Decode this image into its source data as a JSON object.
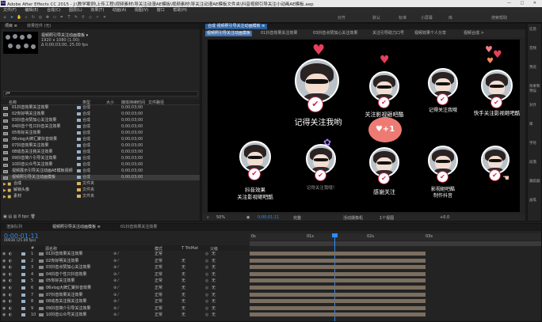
{
  "window": {
    "title": "Adobe After Effects CC 2015 - J:\\教学案例\\上传工程\\视频素材\\导关注动漫AE模板\\视频素材\\导关注动漫AE模板文件夹\\抖音视频引导关注小动画AE模板.aep",
    "app_icon": "Ae",
    "controls": [
      "—",
      "□",
      "✕"
    ]
  },
  "menu": [
    "文件(F)",
    "编辑(E)",
    "合成(C)",
    "图层(L)",
    "效果(T)",
    "动画(A)",
    "视图(V)",
    "窗口",
    "帮助(H)"
  ],
  "toolbar": {
    "right_items": [
      "对齐",
      "默认",
      "标准",
      "小屏幕",
      "库",
      "搜索帮助"
    ]
  },
  "project": {
    "tabs": [
      "项目 ≡",
      "效果控件 (无)"
    ],
    "selected_name": "视频照引导关注动画模板 ▾",
    "selected_info": [
      "1920 x 1080 (1.00)",
      "Δ 0;00;03;00, 25.00 fps"
    ],
    "search_placeholder": "ρ▾",
    "columns": [
      "名称",
      "类型",
      "大小",
      "媒体持续时间",
      "文件路径"
    ],
    "items": [
      {
        "name": "01抖音效果关注效果",
        "type": "合成",
        "dur": "0;00;03;00",
        "color": "#9ab0c8"
      },
      {
        "name": "02你好明关注效果",
        "type": "合成",
        "dur": "0;00;03;00",
        "color": "#9ab0c8"
      },
      {
        "name": "03抖音点赞加心关注效果",
        "type": "合成",
        "dur": "0;00;03;00",
        "color": "#9ab0c8"
      },
      {
        "name": "04抖音个性只抖音关注效果",
        "type": "合成",
        "dur": "0;00;03;00",
        "color": "#9ab0c8"
      },
      {
        "name": "05你好关注效果",
        "type": "合成",
        "dur": "0;00;03;00",
        "color": "#9ab0c8"
      },
      {
        "name": "06vlog大牌汇聚抖音效果",
        "type": "合成",
        "dur": "0;00;03;00",
        "color": "#9ab0c8"
      },
      {
        "name": "07抖音效果关注效果",
        "type": "合成",
        "dur": "0;00;03;00",
        "color": "#9ab0c8"
      },
      {
        "name": "08动态关注我关注效果",
        "type": "合成",
        "dur": "0;00;03;00",
        "color": "#9ab0c8"
      },
      {
        "name": "09抖音简介引导关注效果",
        "type": "合成",
        "dur": "0;00;03;00",
        "color": "#9ab0c8"
      },
      {
        "name": "10抖音公众号关注效果",
        "type": "合成",
        "dur": "0;00;03;00",
        "color": "#9ab0c8"
      },
      {
        "name": "视频展示引导关注动画AE模板视频",
        "type": "合成",
        "dur": "0;00;03;00",
        "color": "#9ab0c8"
      },
      {
        "name": "视频照引导关注动画模板",
        "type": "合成",
        "dur": "0;00;03;00",
        "color": "#9ab0c8",
        "selected": true
      },
      {
        "name": "合成",
        "type": "文件夹",
        "dur": "",
        "color": "#d9b45a",
        "folder": true
      },
      {
        "name": "解锁头像",
        "type": "文件夹",
        "dur": "",
        "color": "#d9b45a",
        "folder": true
      },
      {
        "name": "素材",
        "type": "文件夹",
        "dur": "",
        "color": "#d9b45a",
        "folder": true
      }
    ],
    "footer_bpc": "8 bpc"
  },
  "composition": {
    "tab_label": "合成 视频照引导关注动画模板 ≡",
    "breadcrumbs": [
      "视频照引导关注动画模板",
      "01抖音效果关注效果",
      "03抖音点赞加心关注效果",
      "关注引导助力口号",
      "视频效果个人分享",
      "视频合成 >"
    ],
    "captions": {
      "c1": "记得关注我哟",
      "c2": "关注影视砸吧酷",
      "c3": "记得关注我哦",
      "c4": "快手关注影视砸吧酷",
      "c5a": "抖音效果",
      "c5b": "关注影视砸吧酷",
      "c6": "记得关注我哦！",
      "c7": "感谢关注",
      "c7_bubble": "♥+1",
      "c8a": "影视砸吧酷",
      "c8b": "制作抖音",
      "check": "✔",
      "heart": "♥"
    },
    "footer": {
      "zoom": "50%",
      "timecode": "0;00;01;11",
      "resolution": "完整",
      "camera": "活动摄像机",
      "views": "1个视图",
      "exposure": "+0.0"
    }
  },
  "right_panels": [
    "信息",
    "音频",
    "预览",
    "效果和预设",
    "对齐",
    "库",
    "字符",
    "段落",
    "跟踪器",
    "画笔"
  ],
  "timeline": {
    "tabs": [
      "渲染队列",
      "视频照引导关注动画模板 ≡",
      "01抖音效果关注效果"
    ],
    "timecode": "0;00;01;11",
    "timecode_sub": "00036 (25.00 fps)",
    "columns": [
      "#",
      "源名称",
      "模式",
      "T TrkMat",
      "父级"
    ],
    "layers": [
      {
        "num": "1",
        "name": "01抖音效果关注效果",
        "mode": "正常",
        "trk": "",
        "parent": "无"
      },
      {
        "num": "2",
        "name": "02你好明关注效果",
        "mode": "正常",
        "trk": "无",
        "parent": "无"
      },
      {
        "num": "3",
        "name": "03抖音点赞加心关注效果",
        "mode": "正常",
        "trk": "无",
        "parent": "无"
      },
      {
        "num": "4",
        "name": "04抖音个性只抖音效果",
        "mode": "正常",
        "trk": "无",
        "parent": "无"
      },
      {
        "num": "5",
        "name": "05你好关注效果",
        "mode": "正常",
        "trk": "无",
        "parent": "无"
      },
      {
        "num": "6",
        "name": "06vlog大牌汇聚抖音效果",
        "mode": "正常",
        "trk": "无",
        "parent": "无"
      },
      {
        "num": "7",
        "name": "07抖音效果关注效果",
        "mode": "正常",
        "trk": "无",
        "parent": "无"
      },
      {
        "num": "8",
        "name": "08动态关注我关注效果",
        "mode": "正常",
        "trk": "无",
        "parent": "无"
      },
      {
        "num": "9",
        "name": "09抖音简介引导关注效果",
        "mode": "正常",
        "trk": "无",
        "parent": "无"
      },
      {
        "num": "10",
        "name": "10抖音公众号关注效果",
        "mode": "正常",
        "trk": "无",
        "parent": "无"
      }
    ],
    "ruler": [
      "0s",
      "01s",
      "02s",
      "03s"
    ]
  },
  "colors": {
    "accent_blue": "#2c8df4",
    "heart_red": "#e93e5a",
    "folder": "#d9b45a"
  }
}
